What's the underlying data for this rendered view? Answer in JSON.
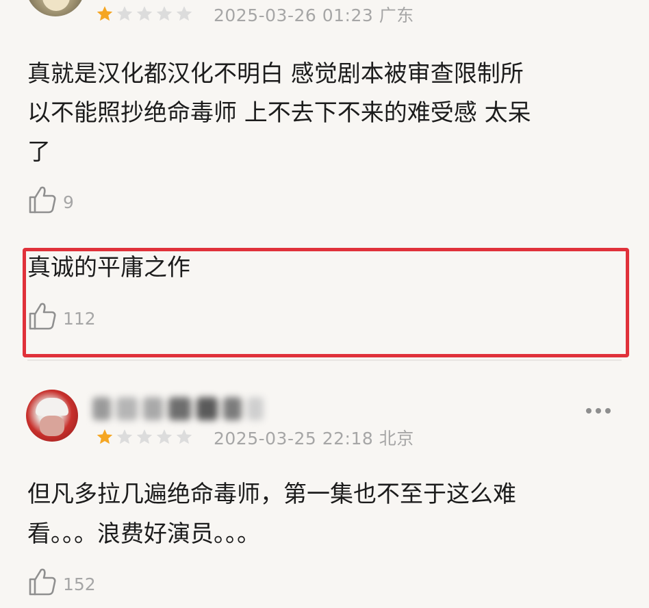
{
  "comments": [
    {
      "rating": 1,
      "max_rating": 5,
      "meta": "2025-03-26 01:23 广东",
      "text_lines": [
        "真就是汉化都汉化不明白  感觉剧本被审查限制所",
        "以不能照抄绝命毒师  上不去下不来的难受感 太呆",
        "了"
      ],
      "likes": "9",
      "reply": {
        "text": "真诚的平庸之作",
        "likes": "112"
      }
    },
    {
      "rating": 1,
      "max_rating": 5,
      "meta": "2025-03-25 22:18 北京",
      "text_lines": [
        "但凡多拉几遍绝命毒师，第一集也不至于这么难",
        "看。。。浪费好演员。。。"
      ],
      "likes": "152"
    }
  ],
  "colors": {
    "background": "#f8f6f3",
    "star_filled": "#f5a623",
    "star_empty": "#dcdcdc",
    "highlight": "#e0313a",
    "meta_text": "#a6a6a6"
  },
  "icons": {
    "like": "thumbs-up-icon",
    "more": "more-dots-icon",
    "star": "star-icon"
  }
}
